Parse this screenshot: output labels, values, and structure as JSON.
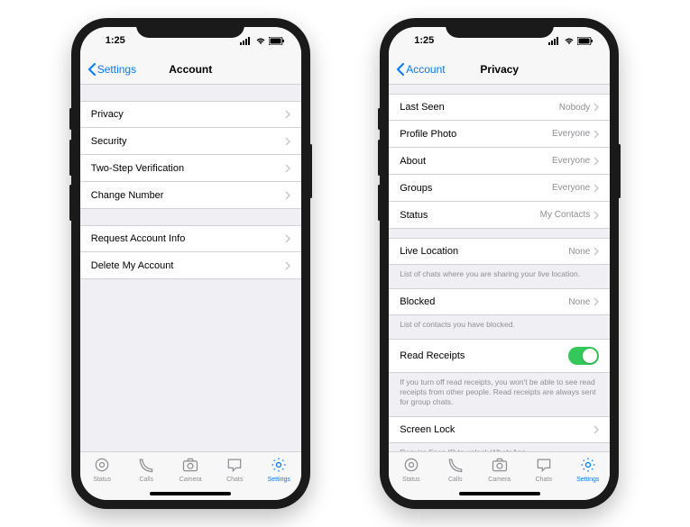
{
  "time": "1:25",
  "left": {
    "back": "Settings",
    "title": "Account",
    "rows1": [
      {
        "label": "Privacy"
      },
      {
        "label": "Security"
      },
      {
        "label": "Two-Step Verification"
      },
      {
        "label": "Change Number"
      }
    ],
    "rows2": [
      {
        "label": "Request Account Info"
      },
      {
        "label": "Delete My Account"
      }
    ]
  },
  "right": {
    "back": "Account",
    "title": "Privacy",
    "rows1": [
      {
        "label": "Last Seen",
        "value": "Nobody"
      },
      {
        "label": "Profile Photo",
        "value": "Everyone"
      },
      {
        "label": "About",
        "value": "Everyone"
      },
      {
        "label": "Groups",
        "value": "Everyone"
      },
      {
        "label": "Status",
        "value": "My Contacts"
      }
    ],
    "live_location": {
      "label": "Live Location",
      "value": "None",
      "note": "List of chats where you are sharing your live location."
    },
    "blocked": {
      "label": "Blocked",
      "value": "None",
      "note": "List of contacts you have blocked."
    },
    "read_receipts": {
      "label": "Read Receipts",
      "note": "If you turn off read receipts, you won't be able to see read receipts from other people. Read receipts are always sent for group chats."
    },
    "screen_lock": {
      "label": "Screen Lock",
      "note": "Require Face ID to unlock WhatsApp."
    }
  },
  "tabs": [
    {
      "label": "Status"
    },
    {
      "label": "Calls"
    },
    {
      "label": "Camera"
    },
    {
      "label": "Chats"
    },
    {
      "label": "Settings"
    }
  ]
}
